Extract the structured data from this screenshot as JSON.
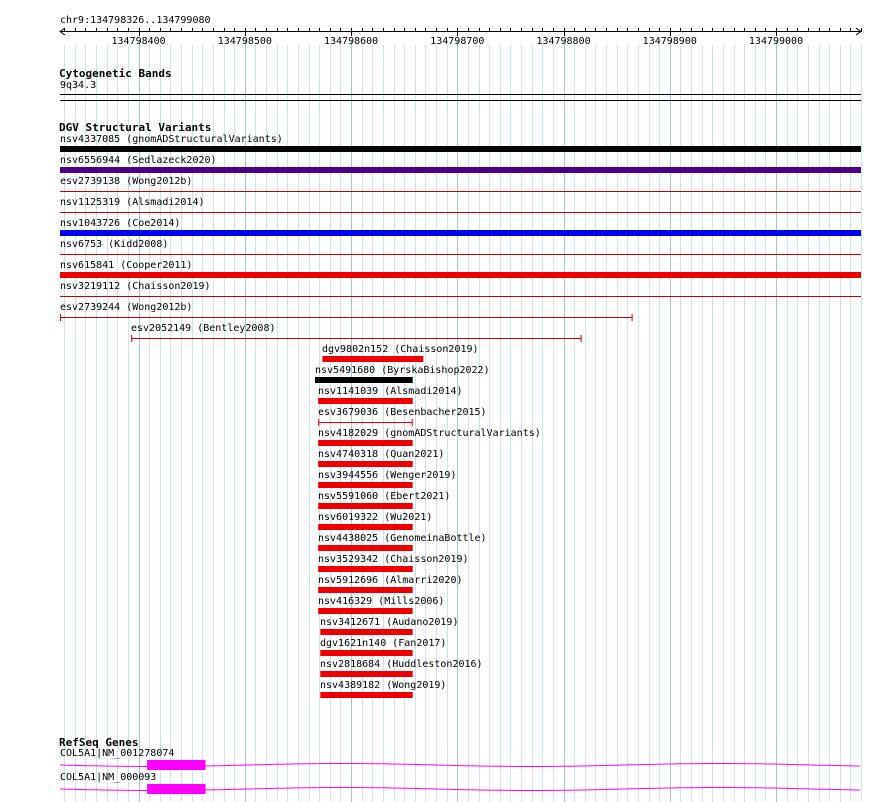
{
  "locus": "chr9:134798326..134799080",
  "ruler": {
    "start": 134798326,
    "end": 134799080,
    "ticks": [
      "134798400",
      "134798500",
      "134798600",
      "134798700",
      "134798800",
      "134798900",
      "134799000"
    ]
  },
  "cytoband": {
    "title": "Cytogenetic Bands",
    "band": "9q34.3"
  },
  "dgv": {
    "title": "DGV Structural Variants",
    "variants": [
      {
        "label": "nsv4337085 (gnomADStructuralVariants)",
        "start": 134798326,
        "end": 134799080,
        "color": "#000000",
        "style": "thick"
      },
      {
        "label": "nsv6556944 (Sedlazeck2020)",
        "start": 134798326,
        "end": 134799080,
        "color": "#4b0082",
        "style": "thick"
      },
      {
        "label": "esv2739138 (Wong2012b)",
        "start": 134798326,
        "end": 134799080,
        "color": "#cc0000",
        "style": "thin"
      },
      {
        "label": "nsv1125319 (Alsmadi2014)",
        "start": 134798326,
        "end": 134799080,
        "color": "#cc0000",
        "style": "thin"
      },
      {
        "label": "nsv1043726 (Coe2014)",
        "start": 134798326,
        "end": 134799080,
        "color": "#0000ee",
        "style": "thick"
      },
      {
        "label": "nsv6753 (Kidd2008)",
        "start": 134798326,
        "end": 134799080,
        "color": "#cc0000",
        "style": "thin"
      },
      {
        "label": "nsv615841 (Cooper2011)",
        "start": 134798326,
        "end": 134799080,
        "color": "#ee0000",
        "style": "thick"
      },
      {
        "label": "nsv3219112 (Chaisson2019)",
        "start": 134798326,
        "end": 134799080,
        "color": "#cc0000",
        "style": "thin"
      },
      {
        "label": "esv2739244 (Wong2012b)",
        "start": 134798326,
        "end": 134798865,
        "color": "#cc0000",
        "style": "capped"
      },
      {
        "label": "esv2052149 (Bentley2008)",
        "start": 134798393,
        "end": 134798817,
        "color": "#cc0000",
        "style": "capped"
      },
      {
        "label": "dgv9802n152 (Chaisson2019)",
        "start": 134798573,
        "end": 134798668,
        "color": "#ee0000",
        "style": "thick"
      },
      {
        "label": "nsv5491680 (ByrskaBishop2022)",
        "start": 134798566,
        "end": 134798658,
        "color": "#000000",
        "style": "thick"
      },
      {
        "label": "nsv1141039 (Alsmadi2014)",
        "start": 134798569,
        "end": 134798658,
        "color": "#ee0000",
        "style": "thick"
      },
      {
        "label": "esv3679036 (Besenbacher2015)",
        "start": 134798569,
        "end": 134798658,
        "color": "#ee0000",
        "style": "capped"
      },
      {
        "label": "nsv4182029 (gnomADStructuralVariants)",
        "start": 134798569,
        "end": 134798658,
        "color": "#ee0000",
        "style": "thick"
      },
      {
        "label": "nsv4740318 (Quan2021)",
        "start": 134798569,
        "end": 134798658,
        "color": "#ee0000",
        "style": "thick"
      },
      {
        "label": "nsv3944556 (Wenger2019)",
        "start": 134798569,
        "end": 134798658,
        "color": "#ee0000",
        "style": "thick"
      },
      {
        "label": "nsv5591060 (Ebert2021)",
        "start": 134798569,
        "end": 134798658,
        "color": "#ee0000",
        "style": "thick"
      },
      {
        "label": "nsv6019322 (Wu2021)",
        "start": 134798569,
        "end": 134798658,
        "color": "#ee0000",
        "style": "thick"
      },
      {
        "label": "nsv4438025 (GenomeinaBottle)",
        "start": 134798569,
        "end": 134798658,
        "color": "#ee0000",
        "style": "thick"
      },
      {
        "label": "nsv3529342 (Chaisson2019)",
        "start": 134798569,
        "end": 134798658,
        "color": "#ee0000",
        "style": "thick"
      },
      {
        "label": "nsv5912696 (Almarri2020)",
        "start": 134798569,
        "end": 134798658,
        "color": "#ee0000",
        "style": "thick"
      },
      {
        "label": "nsv416329 (Mills2006)",
        "start": 134798569,
        "end": 134798658,
        "color": "#ee0000",
        "style": "thick"
      },
      {
        "label": "nsv3412671 (Audano2019)",
        "start": 134798571,
        "end": 134798658,
        "color": "#ee0000",
        "style": "thick"
      },
      {
        "label": "dgv1621n140 (Fan2017)",
        "start": 134798571,
        "end": 134798658,
        "color": "#ee0000",
        "style": "thick"
      },
      {
        "label": "nsv2818684 (Huddleston2016)",
        "start": 134798571,
        "end": 134798658,
        "color": "#ee0000",
        "style": "thick"
      },
      {
        "label": "nsv4389182 (Wong2019)",
        "start": 134798571,
        "end": 134798658,
        "color": "#ee0000",
        "style": "thick"
      }
    ]
  },
  "refseq": {
    "title": "RefSeq Genes",
    "genes": [
      {
        "label": "COL5A1|NM_001278074",
        "exon_start": 134798408,
        "exon_end": 134798463,
        "color": "#ff00ff"
      },
      {
        "label": "COL5A1|NM_000093",
        "exon_start": 134798408,
        "exon_end": 134798463,
        "color": "#ff00ff"
      }
    ]
  }
}
